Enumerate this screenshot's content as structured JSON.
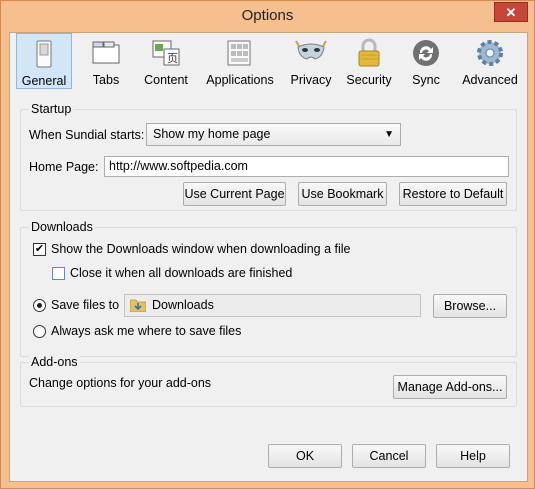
{
  "window": {
    "title": "Options",
    "close_label": "✕"
  },
  "toolbar": {
    "tabs": [
      {
        "label": "General",
        "icon": "switch-icon",
        "active": true
      },
      {
        "label": "Tabs",
        "icon": "tabs-icon"
      },
      {
        "label": "Content",
        "icon": "content-icon"
      },
      {
        "label": "Applications",
        "icon": "applications-icon"
      },
      {
        "label": "Privacy",
        "icon": "mask-icon"
      },
      {
        "label": "Security",
        "icon": "padlock-icon"
      },
      {
        "label": "Sync",
        "icon": "sync-icon"
      },
      {
        "label": "Advanced",
        "icon": "gear-icon"
      }
    ]
  },
  "startup": {
    "title": "Startup",
    "when_starts_label": "When Sundial starts:",
    "when_starts_value": "Show my home page",
    "home_page_label": "Home Page:",
    "home_page_value": "http://www.softpedia.com",
    "use_current_page": "Use Current Page",
    "use_bookmark": "Use Bookmark",
    "restore_default": "Restore to Default"
  },
  "downloads": {
    "title": "Downloads",
    "show_window_label": "Show the Downloads window when downloading a file",
    "show_window_checked": true,
    "close_when_done_label": "Close it when all downloads are finished",
    "close_when_done_checked": false,
    "save_files_label": "Save files to",
    "save_folder": "Downloads",
    "browse": "Browse...",
    "always_ask_label": "Always ask me where to save files",
    "selected_option": "save_files"
  },
  "addons": {
    "title": "Add-ons",
    "description": "Change options for your add-ons",
    "manage": "Manage Add-ons..."
  },
  "footer": {
    "ok": "OK",
    "cancel": "Cancel",
    "help": "Help"
  },
  "colors": {
    "frame": "#f6c08e",
    "active_tab": "#d3e6f7",
    "close": "#c7463a"
  }
}
